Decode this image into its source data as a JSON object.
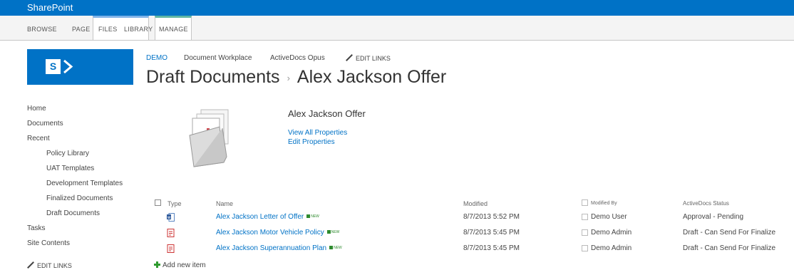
{
  "suite_bar": {
    "brand": "SharePoint"
  },
  "ribbon": {
    "tabs": [
      "BROWSE",
      "PAGE",
      "FILES",
      "LIBRARY",
      "MANAGE"
    ]
  },
  "top_nav": {
    "items": [
      "DEMO",
      "Document Workplace",
      "ActiveDocs Opus"
    ],
    "edit_links": "EDIT LINKS"
  },
  "breadcrumb": {
    "parent": "Draft Documents",
    "separator": "›",
    "current": "Alex Jackson Offer"
  },
  "quick_launch": {
    "items": [
      "Home",
      "Documents",
      "Recent",
      "Policy Library",
      "UAT Templates",
      "Development Templates",
      "Finalized Documents",
      "Draft Documents",
      "Tasks",
      "Site Contents"
    ],
    "edit_links": "EDIT LINKS"
  },
  "document_set": {
    "name": "Alex Jackson Offer",
    "view_all": "View All Properties",
    "edit": "Edit Properties"
  },
  "list": {
    "headers": {
      "type": "Type",
      "name": "Name",
      "modified": "Modified",
      "modified_by": "Modified By",
      "status": "ActiveDocs Status"
    },
    "new_badge": "NEW",
    "rows": [
      {
        "icon": "word-doc-icon",
        "name": "Alex Jackson Letter of Offer",
        "modified": "8/7/2013 5:52 PM",
        "modified_by": "Demo User",
        "status": "Approval - Pending"
      },
      {
        "icon": "pdf-doc-icon",
        "name": "Alex Jackson Motor Vehicle Policy",
        "modified": "8/7/2013 5:45 PM",
        "modified_by": "Demo Admin",
        "status": "Draft - Can Send For Finalize"
      },
      {
        "icon": "pdf-doc-icon",
        "name": "Alex Jackson Superannuation Plan",
        "modified": "8/7/2013 5:45 PM",
        "modified_by": "Demo Admin",
        "status": "Draft - Can Send For Finalize"
      }
    ],
    "add_new": "Add new item"
  },
  "colors": {
    "suite_bar": "#0072c6",
    "link": "#0072c6",
    "files_tab": "#7fb3e8",
    "manage_tab": "#5fb6a4",
    "new_badge": "#2e8b2e"
  }
}
